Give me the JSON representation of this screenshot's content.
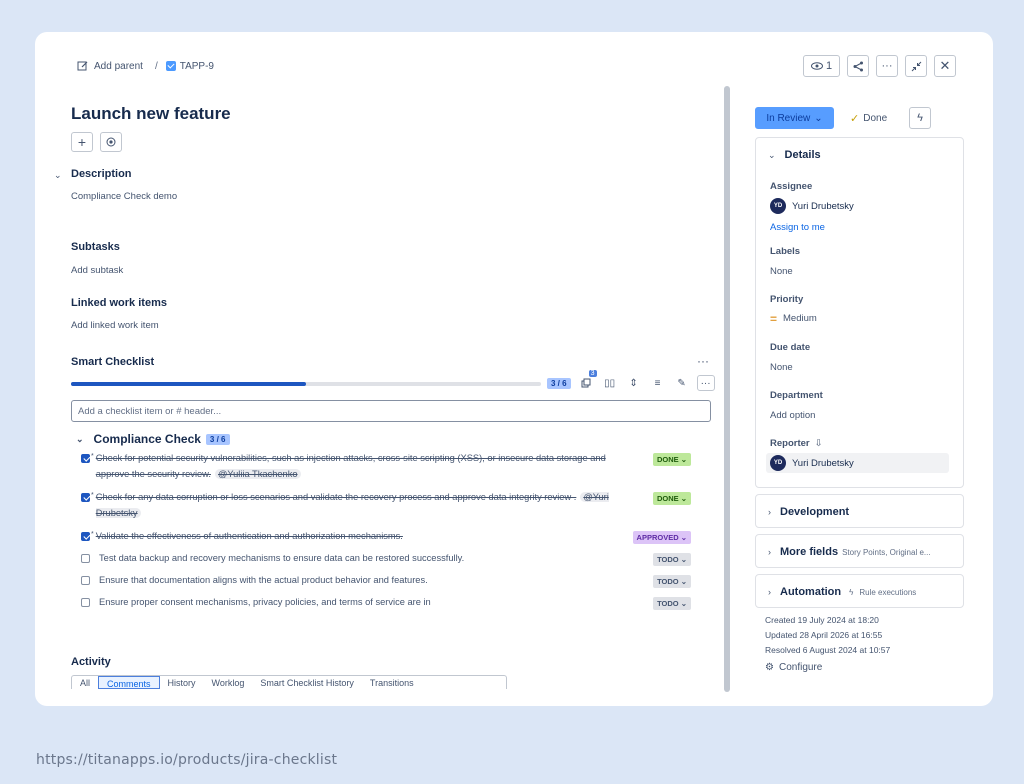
{
  "breadcrumb": {
    "add_parent": "Add parent",
    "separator": "/",
    "issue_key": "TAPP-9"
  },
  "top_actions": {
    "watchers": "1"
  },
  "issue": {
    "title": "Launch new feature"
  },
  "description": {
    "heading": "Description",
    "text": "Compliance Check demo"
  },
  "subtasks": {
    "heading": "Subtasks",
    "placeholder": "Add subtask"
  },
  "linked": {
    "heading": "Linked work items",
    "placeholder": "Add linked work item"
  },
  "smart_checklist": {
    "heading": "Smart Checklist",
    "progress_label": "3 / 6",
    "progress_fraction": 0.5,
    "comments_badge": "3",
    "input_placeholder": "Add a checklist item or # header...",
    "group": {
      "title": "Compliance Check",
      "count": "3 / 6",
      "items": [
        {
          "text": "Check for potential security vulnerabilities, such as injection attacks, cross-site scripting (XSS), or insecure data storage and approve the security review.",
          "mention": "@Yuliia Tkachenko",
          "status": "DONE",
          "done": true
        },
        {
          "text": "Check for any data corruption or loss scenarios and validate the recovery process and approve data integrity review .",
          "mention": "@Yuri Drubetsky",
          "status": "DONE",
          "done": true
        },
        {
          "text": "Validate the effectiveness of authentication and authorization mechanisms.",
          "mention": "",
          "status": "APPROVED",
          "done": true
        },
        {
          "text": "Test data backup and recovery mechanisms to ensure data can be restored successfully.",
          "mention": "",
          "status": "TODO",
          "done": false
        },
        {
          "text": "Ensure that documentation aligns with the actual product behavior and features.",
          "mention": "",
          "status": "TODO",
          "done": false
        },
        {
          "text": "Ensure proper consent mechanisms, privacy policies, and terms of service are in",
          "mention": "",
          "status": "TODO",
          "done": false
        }
      ]
    }
  },
  "activity": {
    "heading": "Activity",
    "tabs": [
      "All",
      "Comments",
      "History",
      "Worklog",
      "Smart Checklist History",
      "Transitions"
    ]
  },
  "status": {
    "current": "In Review",
    "done_label": "Done"
  },
  "details": {
    "heading": "Details",
    "assignee_label": "Assignee",
    "assignee_initials": "YD",
    "assignee_name": "Yuri Drubetsky",
    "assign_to_me": "Assign to me",
    "labels_label": "Labels",
    "labels_value": "None",
    "priority_label": "Priority",
    "priority_value": "Medium",
    "due_label": "Due date",
    "due_value": "None",
    "department_label": "Department",
    "department_value": "Add option",
    "reporter_label": "Reporter",
    "reporter_initials": "YD",
    "reporter_name": "Yuri Drubetsky"
  },
  "development": {
    "heading": "Development"
  },
  "more_fields": {
    "heading": "More fields",
    "sub": "Story Points, Original e..."
  },
  "automation": {
    "heading": "Automation",
    "sub": "Rule executions"
  },
  "meta": {
    "created": "Created 19 July 2024 at 18:20",
    "updated": "Updated 28 April 2026 at 16:55",
    "resolved": "Resolved 6 August 2024 at 10:57",
    "configure": "Configure"
  },
  "footer_url": "https://titanapps.io/products/jira-checklist",
  "colors": {
    "accent": "#1d56c0",
    "status_blue": "#579dff",
    "done_green": "#bde89a",
    "approved_purple": "#dcc4f7"
  }
}
